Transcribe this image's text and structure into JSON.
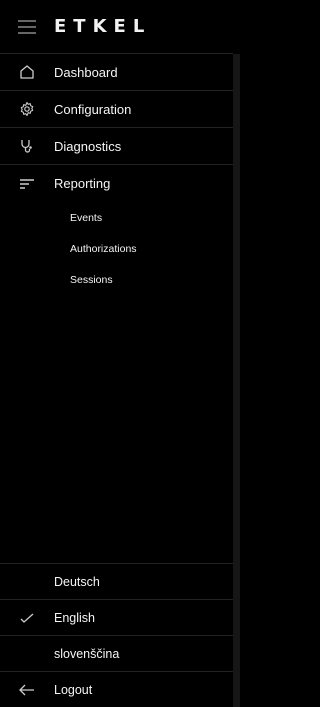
{
  "brand": {
    "logo_text": "ETKEL"
  },
  "nav": {
    "items": [
      {
        "label": "Dashboard",
        "icon": "home-icon"
      },
      {
        "label": "Configuration",
        "icon": "gear-icon"
      },
      {
        "label": "Diagnostics",
        "icon": "stethoscope-icon"
      },
      {
        "label": "Reporting",
        "icon": "list-icon"
      }
    ],
    "reporting_sub": [
      "Events",
      "Authorizations",
      "Sessions"
    ]
  },
  "languages": [
    {
      "label": "Deutsch",
      "selected": false
    },
    {
      "label": "English",
      "selected": true
    },
    {
      "label": "slovenščina",
      "selected": false
    }
  ],
  "logout": {
    "label": "Logout",
    "icon": "arrow-left-icon"
  },
  "colors": {
    "background": "#000000",
    "text": "#f5f5f5",
    "divider": "#222222",
    "scrollbar": "#161616"
  }
}
